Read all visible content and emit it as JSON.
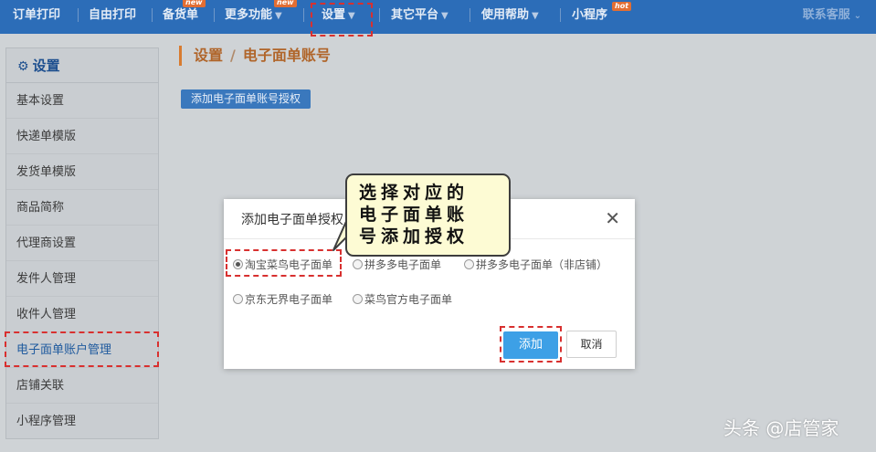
{
  "nav": {
    "items": [
      {
        "label": "订单打印"
      },
      {
        "label": "自由打印"
      },
      {
        "label": "备货单",
        "badge": "new"
      },
      {
        "label": "更多功能",
        "badge": "new",
        "arrow": "▼"
      },
      {
        "label": "设置",
        "arrow": "▼"
      },
      {
        "label": "其它平台",
        "arrow": "▼"
      },
      {
        "label": "使用帮助",
        "arrow": "▼"
      },
      {
        "label": "小程序",
        "badge": "hot"
      }
    ],
    "service": {
      "label": "联系客服",
      "arrow": "⌄"
    }
  },
  "sidebar": {
    "header": {
      "icon": "gear-icon",
      "title": "设置"
    },
    "items": [
      {
        "label": "基本设置"
      },
      {
        "label": "快递单模版"
      },
      {
        "label": "发货单模版"
      },
      {
        "label": "商品简称"
      },
      {
        "label": "代理商设置"
      },
      {
        "label": "发件人管理"
      },
      {
        "label": "收件人管理"
      },
      {
        "label": "电子面单账户管理",
        "active": true
      },
      {
        "label": "店铺关联"
      },
      {
        "label": "小程序管理"
      }
    ]
  },
  "breadcrumb": {
    "parent": "设置",
    "separator": "/",
    "current": "电子面单账号"
  },
  "add_auth_button": "添加电子面单账号授权",
  "modal": {
    "title": "添加电子面单授权",
    "close_icon": "close-icon",
    "options": [
      {
        "label": "淘宝菜鸟电子面单",
        "checked": true
      },
      {
        "label": "拼多多电子面单",
        "checked": false
      },
      {
        "label": "拼多多电子面单（非店铺）",
        "checked": false
      },
      {
        "label": "京东无界电子面单",
        "checked": false
      },
      {
        "label": "菜鸟官方电子面单",
        "checked": false
      }
    ],
    "add_button": "添加",
    "cancel_button": "取消"
  },
  "callout": {
    "lines": [
      "选择对应的",
      "电子面单账",
      "号添加授权"
    ]
  },
  "watermark": "头条 @店管家",
  "colors": {
    "nav_bg": "#2c6db8",
    "accent": "#d87b30",
    "primary_button": "#3da0e6",
    "highlight": "#d8302f"
  }
}
